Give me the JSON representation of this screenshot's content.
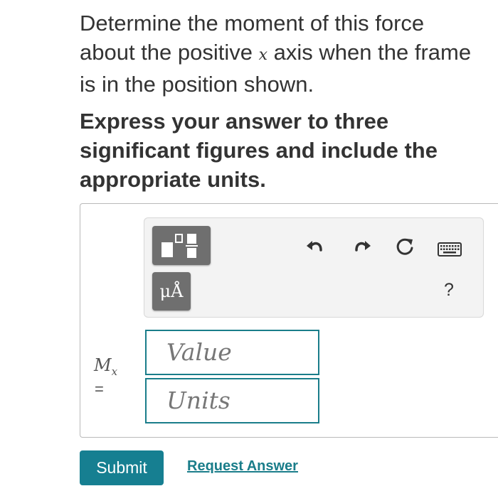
{
  "question": {
    "text_before": "Determine the moment of this force about the positive ",
    "variable": "x",
    "text_after": " axis when the frame is in the position shown."
  },
  "instruction": "Express your answer to three significant figures and include the appropriate units.",
  "toolbar": {
    "units_label": "μÅ",
    "help_label": "?",
    "icons": [
      "templates-icon",
      "undo-icon",
      "redo-icon",
      "reset-icon",
      "keyboard-icon"
    ]
  },
  "answer": {
    "var_symbol": "M",
    "var_subscript": "x",
    "equals": "=",
    "value_placeholder": "Value",
    "units_placeholder": "Units"
  },
  "actions": {
    "submit_label": "Submit",
    "request_label": "Request Answer"
  },
  "colors": {
    "accent": "#167f91",
    "toolbar_button": "#6f6f6f"
  }
}
